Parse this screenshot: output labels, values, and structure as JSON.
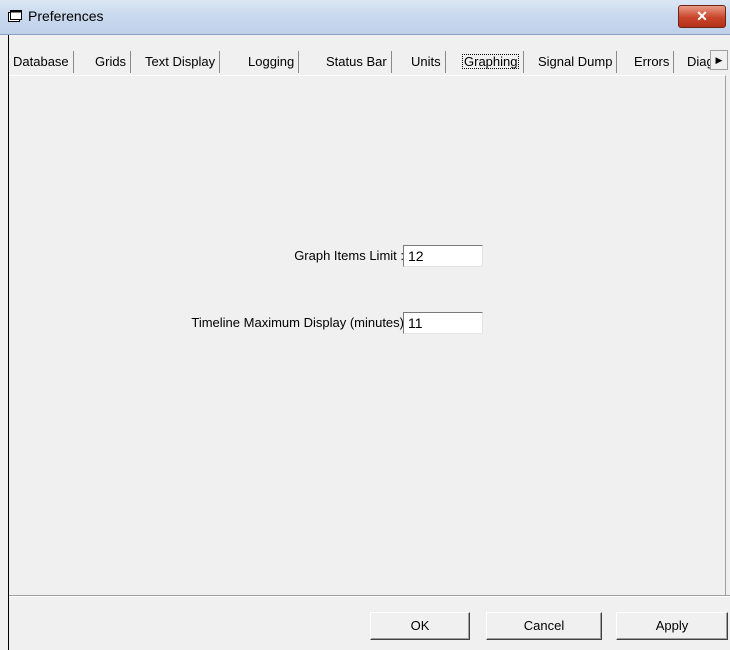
{
  "window": {
    "title": "Preferences",
    "close_label": "✕"
  },
  "tabs": [
    {
      "label": "Database"
    },
    {
      "label": "Grids"
    },
    {
      "label": "Text Display"
    },
    {
      "label": "Logging"
    },
    {
      "label": "Status Bar"
    },
    {
      "label": "Units"
    },
    {
      "label": "Graphing",
      "active": true
    },
    {
      "label": "Signal Dump"
    },
    {
      "label": "Errors"
    },
    {
      "label": "Diag"
    }
  ],
  "tab_scroll_icon": "scroll-right-icon",
  "fields": {
    "graph_items_limit": {
      "label": "Graph Items Limit :",
      "value": "12"
    },
    "timeline_max_display": {
      "label": "Timeline Maximum Display (minutes)",
      "value": "11"
    }
  },
  "buttons": {
    "ok": "OK",
    "cancel": "Cancel",
    "apply": "Apply"
  }
}
